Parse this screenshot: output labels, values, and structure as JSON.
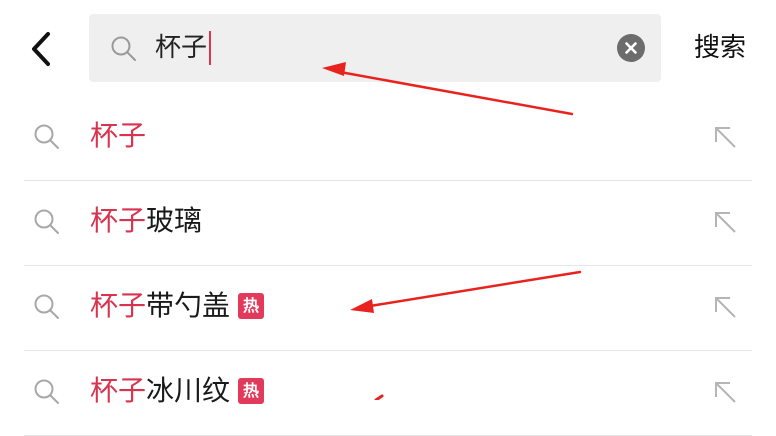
{
  "header": {
    "back_icon": "chevron-left-icon",
    "search": {
      "value": "杯子",
      "icon": "search-icon",
      "clear_icon": "clear-circle-icon"
    },
    "action_label": "搜索"
  },
  "suggestions": [
    {
      "highlight": "杯子",
      "rest": "",
      "badge": ""
    },
    {
      "highlight": "杯子",
      "rest": "玻璃",
      "badge": ""
    },
    {
      "highlight": "杯子",
      "rest": "带勺盖",
      "badge": "热"
    },
    {
      "highlight": "杯子",
      "rest": "冰川纹",
      "badge": "热"
    }
  ],
  "colors": {
    "highlight": "#d8344f",
    "badge": "#e23a5a",
    "annotation_arrow": "#e8231f",
    "search_bg": "#efefef"
  },
  "icons": {
    "row_icon": "search-icon",
    "fill_icon": "arrow-up-left-icon",
    "annotation": "red-arrow-icon"
  }
}
